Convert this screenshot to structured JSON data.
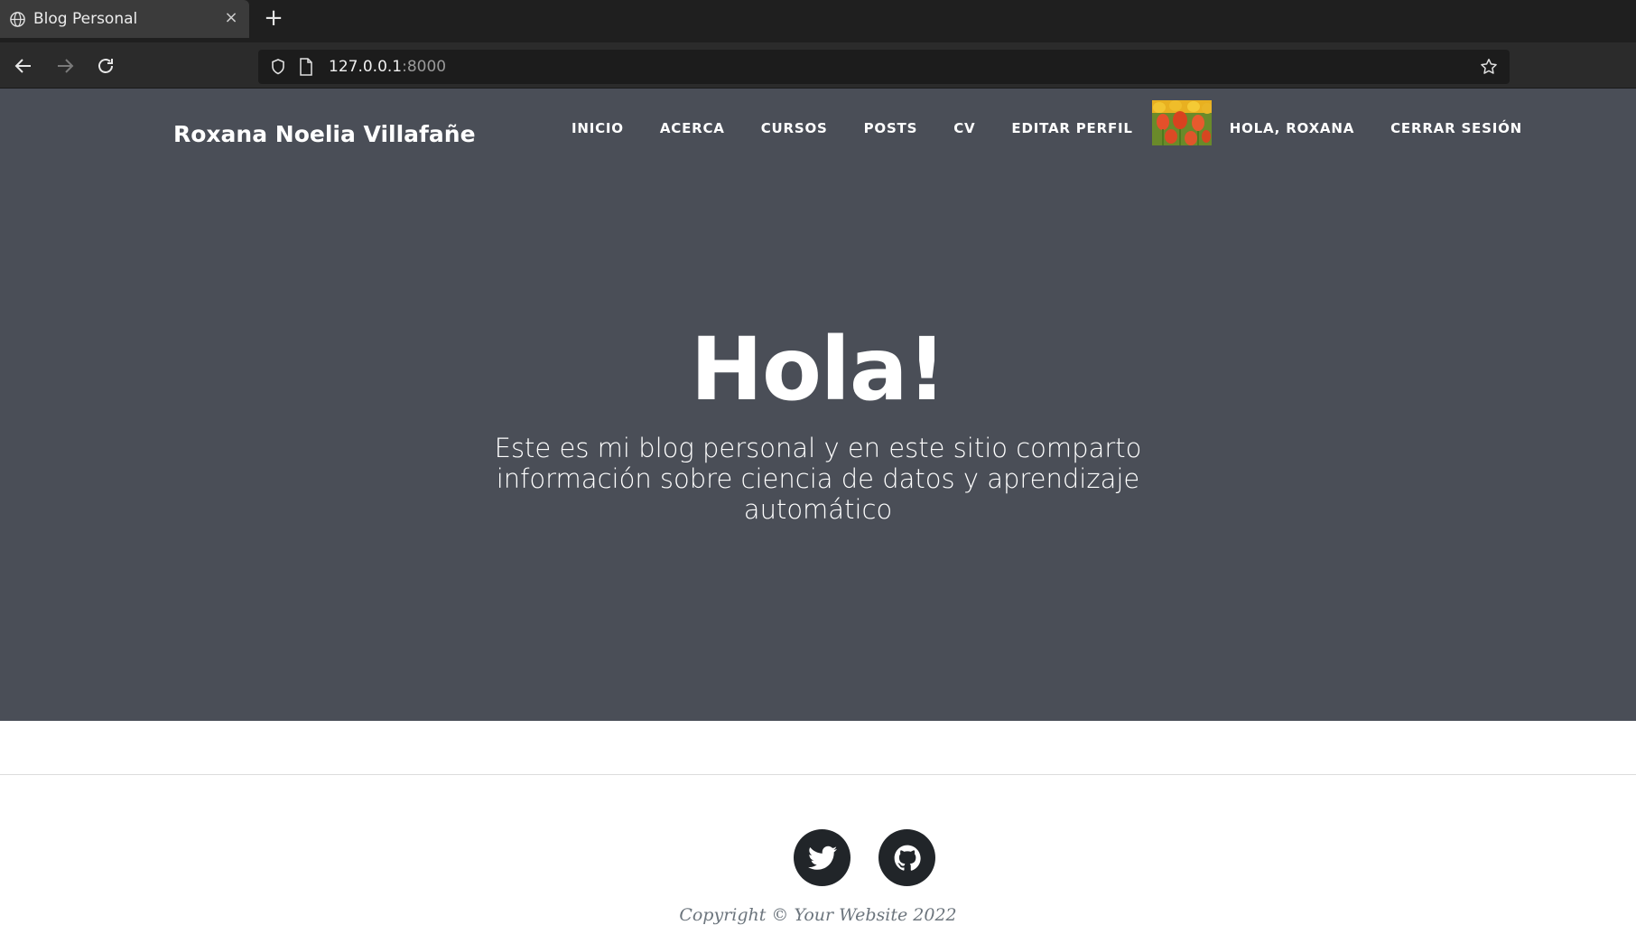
{
  "browser": {
    "tab_title": "Blog Personal",
    "url_host": "127.0.0.1",
    "url_port": ":8000"
  },
  "site": {
    "brand": "Roxana Noelia Villafañe",
    "nav": {
      "inicio": "Inicio",
      "acerca": "Acerca",
      "cursos": "Cursos",
      "posts": "Posts",
      "cv": "CV",
      "editar_perfil": "Editar Perfil",
      "hola": "Hola, Roxana",
      "cerrar_sesion": "Cerrar Sesión"
    }
  },
  "hero": {
    "title": "Hola!",
    "subtitle": "Este es mi blog personal y en este sitio comparto información sobre ciencia de datos y aprendizaje automático"
  },
  "footer": {
    "social": [
      "twitter-icon",
      "github-icon"
    ],
    "copyright": "Copyright © Your Website 2022"
  },
  "colors": {
    "hero_bg": "#4a4e57",
    "social_bg": "#212529"
  }
}
